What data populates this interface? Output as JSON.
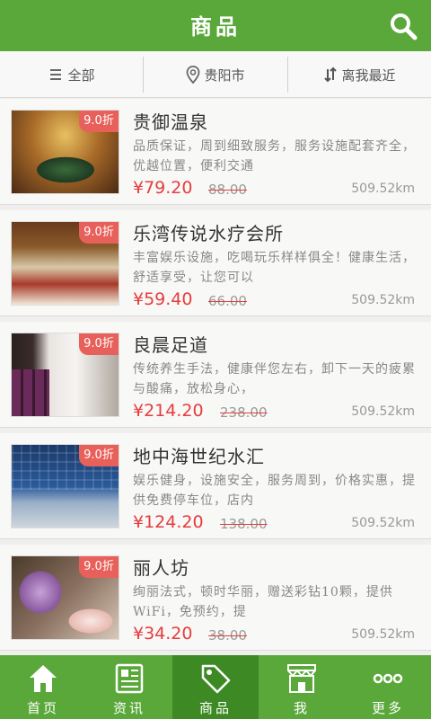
{
  "header": {
    "title": "商品",
    "search_icon": "search-icon"
  },
  "filters": {
    "category": "全部",
    "city": "贵阳市",
    "sort": "离我最近"
  },
  "products": [
    {
      "name": "贵御温泉",
      "badge": "9.0折",
      "desc": "品质保证，周到细致服务，服务设施配套齐全，优越位置，便利交通",
      "price": "¥79.20",
      "original": "88.00",
      "distance": "509.52km"
    },
    {
      "name": "乐湾传说水疗会所",
      "badge": "9.0折",
      "desc": "丰富娱乐设施，吃喝玩乐样样俱全！健康生活，舒适享受，让您可以",
      "price": "¥59.40",
      "original": "66.00",
      "distance": "509.52km"
    },
    {
      "name": "良晨足道",
      "badge": "9.0折",
      "desc": "传统养生手法，健康伴您左右，卸下一天的疲累与酸痛，放松身心，",
      "price": "¥214.20",
      "original": "238.00",
      "distance": "509.52km"
    },
    {
      "name": "地中海世纪水汇",
      "badge": "9.0折",
      "desc": "娱乐健身，设施安全，服务周到，价格实惠，提供免费停车位，店内",
      "price": "¥124.20",
      "original": "138.00",
      "distance": "509.52km"
    },
    {
      "name": "丽人坊",
      "badge": "9.0折",
      "desc": "绚丽法式，顿时华丽，赠送彩钻10颗，提供WiFi，免预约，提",
      "price": "¥34.20",
      "original": "38.00",
      "distance": "509.52km"
    }
  ],
  "tabs": [
    {
      "label": "首页",
      "icon": "home-icon"
    },
    {
      "label": "资讯",
      "icon": "news-icon"
    },
    {
      "label": "商品",
      "icon": "tag-icon",
      "active": true
    },
    {
      "label": "我",
      "icon": "shop-icon"
    },
    {
      "label": "更多",
      "icon": "more-icon"
    }
  ],
  "colors": {
    "brand": "#5aa83a",
    "brand_active": "#3d8a24",
    "price": "#e53d3d",
    "badge": "#e8605a"
  }
}
